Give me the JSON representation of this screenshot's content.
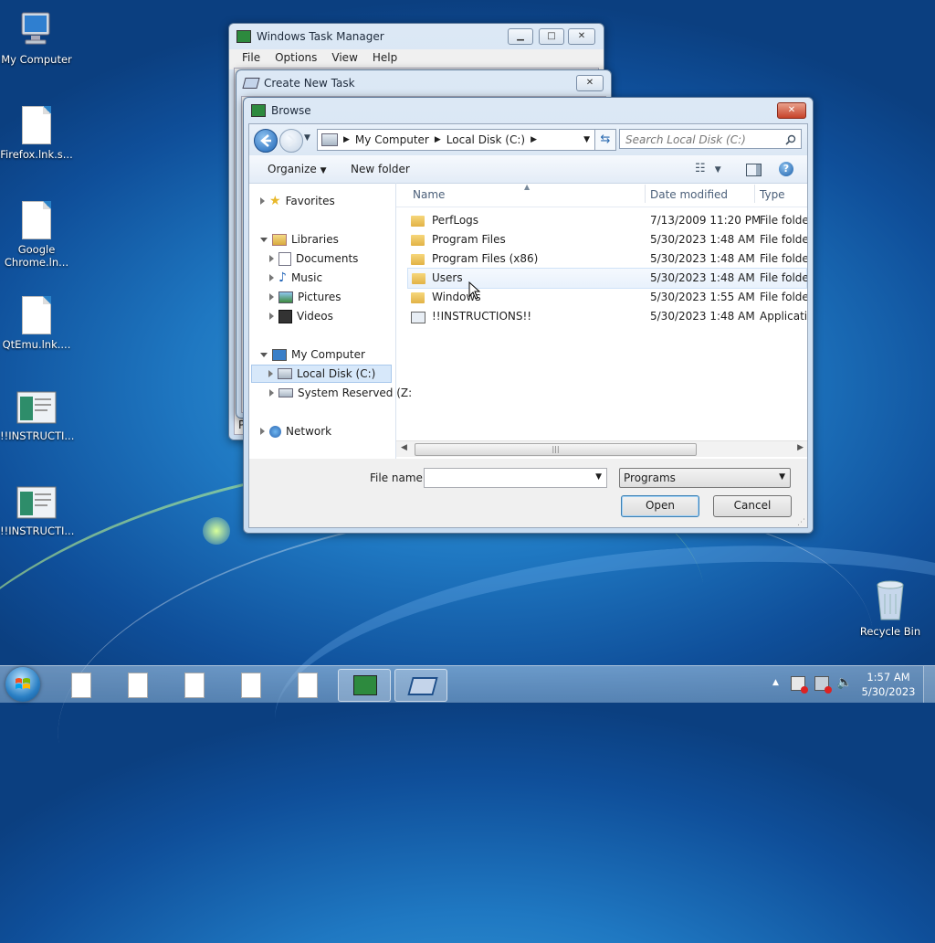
{
  "desktop": {
    "icons": [
      {
        "label": "My Computer"
      },
      {
        "label": "Firefox.lnk.s..."
      },
      {
        "label": "Google Chrome.ln..."
      },
      {
        "label": "QtEmu.lnk...."
      },
      {
        "label": "!!INSTRUCTI..."
      },
      {
        "label": "!!INSTRUCTI..."
      },
      {
        "label": "Recycle Bin"
      }
    ]
  },
  "task_manager": {
    "title": "Windows Task Manager",
    "menu": [
      "File",
      "Options",
      "View",
      "Help"
    ],
    "footer_fragment": "P"
  },
  "create_task": {
    "title": "Create New Task"
  },
  "browse": {
    "title": "Browse",
    "address": {
      "crumb1": "My Computer",
      "crumb2": "Local Disk (C:)"
    },
    "search_placeholder": "Search Local Disk (C:)",
    "toolbar": {
      "organize": "Organize",
      "new_folder": "New folder"
    },
    "tree": {
      "favorites": "Favorites",
      "libraries": "Libraries",
      "documents": "Documents",
      "music": "Music",
      "pictures": "Pictures",
      "videos": "Videos",
      "my_computer": "My Computer",
      "local_disk": "Local Disk (C:)",
      "system_reserved": "System Reserved (Z:",
      "network": "Network"
    },
    "columns": {
      "name": "Name",
      "date": "Date modified",
      "type": "Type"
    },
    "files": [
      {
        "name": "PerfLogs",
        "date": "7/13/2009 11:20 PM",
        "type": "File folder",
        "kind": "folder"
      },
      {
        "name": "Program Files",
        "date": "5/30/2023 1:48 AM",
        "type": "File folder",
        "kind": "folder"
      },
      {
        "name": "Program Files (x86)",
        "date": "5/30/2023 1:48 AM",
        "type": "File folder",
        "kind": "folder"
      },
      {
        "name": "Users",
        "date": "5/30/2023 1:48 AM",
        "type": "File folder",
        "kind": "folder"
      },
      {
        "name": "Windows",
        "date": "5/30/2023 1:55 AM",
        "type": "File folder",
        "kind": "folder"
      },
      {
        "name": "!!INSTRUCTIONS!!",
        "date": "5/30/2023 1:48 AM",
        "type": "Applicatio",
        "kind": "app"
      }
    ],
    "file_name_label": "File name:",
    "file_name_value": "",
    "file_type_value": "Programs",
    "open_label": "Open",
    "cancel_label": "Cancel"
  },
  "taskbar": {
    "time": "1:57 AM",
    "date": "5/30/2023"
  }
}
